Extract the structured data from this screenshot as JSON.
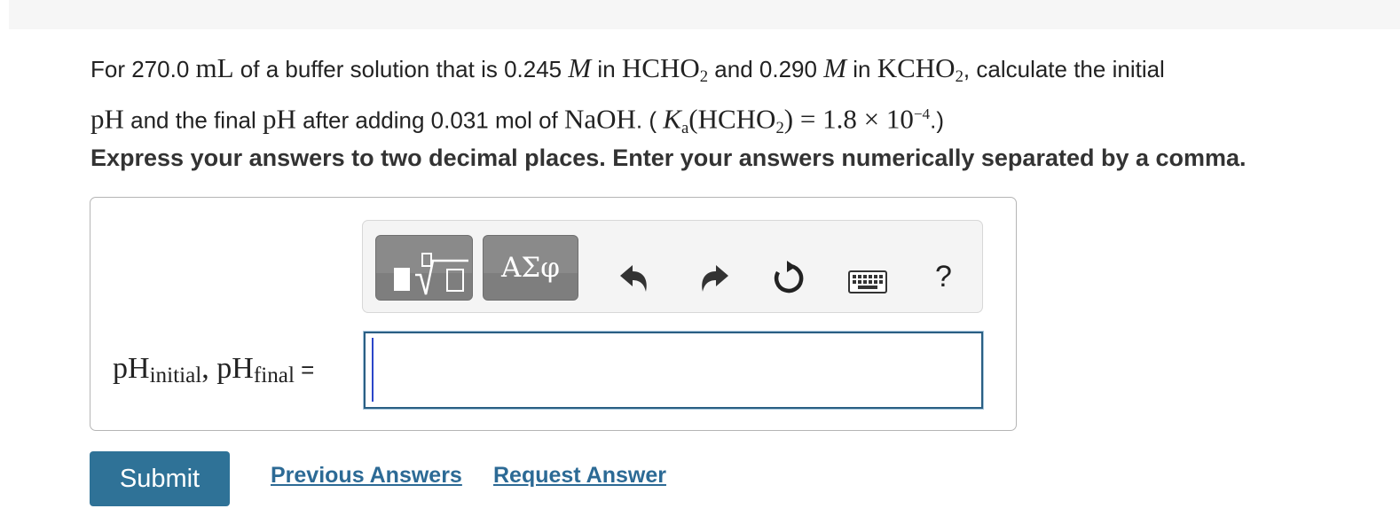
{
  "question": {
    "text_1": "For 270.0 ",
    "unit_mL": "mL",
    "text_2": " of a buffer solution that is 0.245 ",
    "M": "M",
    "in": " in ",
    "HCHO": "HCHO",
    "sub_2": "2",
    "text_and": " and 0.290 ",
    "KCHO": "KCHO",
    "text_calc": ", calculate the initial",
    "pH": "pH",
    "text_final": " and the final ",
    "text_adding": " after adding 0.031 mol of ",
    "NaOH": "NaOH",
    "text_paren": ". ( ",
    "K": "K",
    "a": "a",
    "open": "(",
    "close_eq": ") = 1.8 × 10",
    "exp": "−4",
    "end": ".)"
  },
  "instruction": "Express your answers to two decimal places. Enter your answers numerically separated by a comma.",
  "toolbar": {
    "templates_icon": "templates-radical-icon",
    "greek_label": "ΑΣφ",
    "undo_icon": "undo-icon",
    "redo_icon": "redo-icon",
    "reset_icon": "reset-icon",
    "keyboard_icon": "keyboard-icon",
    "help_label": "?"
  },
  "answer": {
    "label_pH": "pH",
    "label_initial": "initial",
    "label_comma": ", ",
    "label_final": "final",
    "label_eq": " =",
    "value": ""
  },
  "actions": {
    "submit": "Submit",
    "previous": "Previous Answers",
    "request": "Request Answer"
  },
  "colors": {
    "submit_bg": "#2f7297",
    "link": "#2c6a95",
    "toolbar_button": "#8a8a8a",
    "input_border": "#2a5f84",
    "caret": "#2b46c9"
  }
}
